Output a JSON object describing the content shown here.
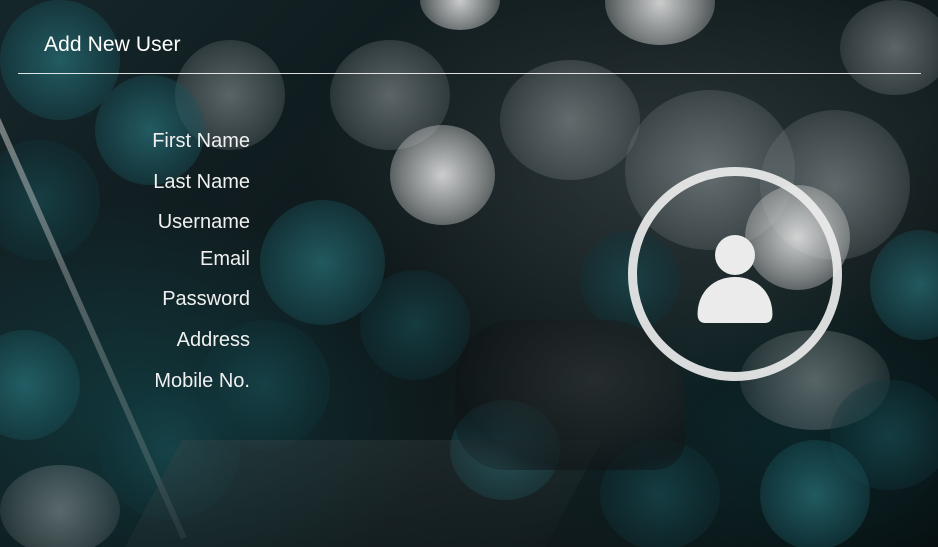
{
  "header": {
    "title": "Add New User"
  },
  "form": {
    "labels": [
      "First Name",
      "Last Name",
      "Username",
      "Email",
      "Password",
      "Address",
      "Mobile No."
    ]
  },
  "avatar": {
    "icon": "user-avatar-icon",
    "color": "#ebebeb"
  },
  "theme": {
    "background": "#0c1416",
    "accent_teal": "#1a545c",
    "text": "#ffffff"
  }
}
